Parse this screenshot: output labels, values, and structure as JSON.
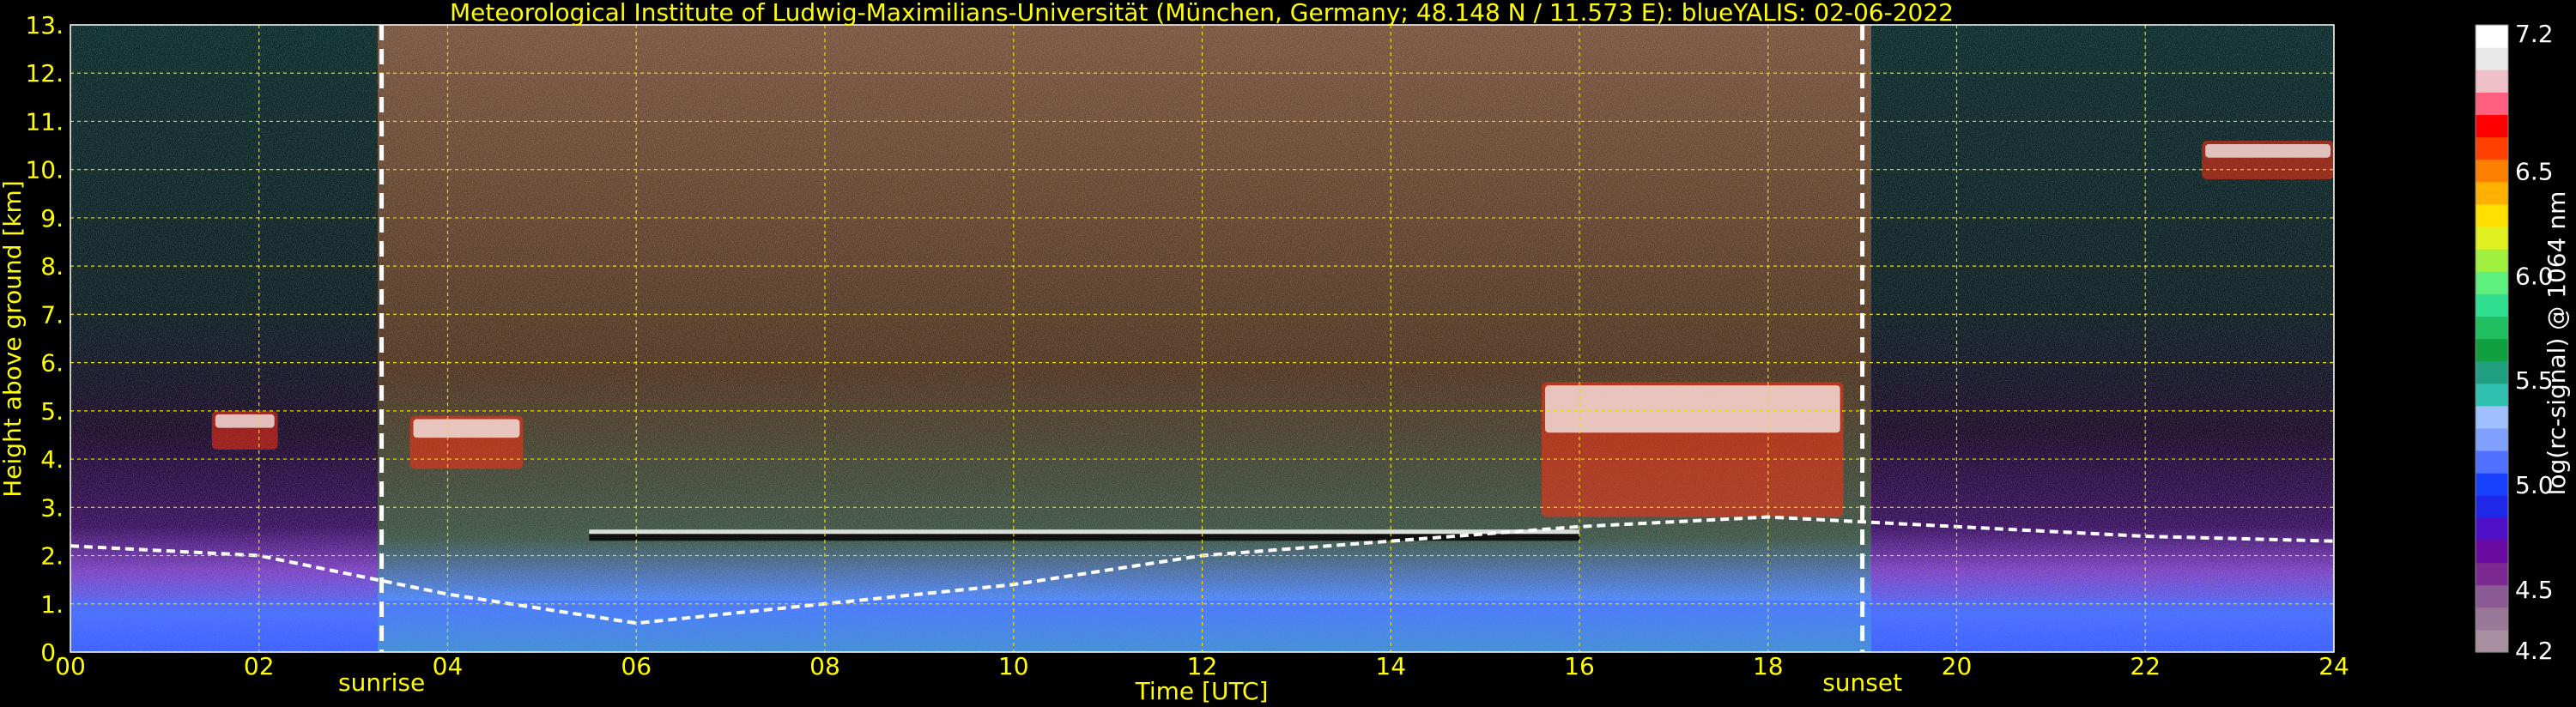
{
  "chart_data": {
    "type": "heatmap",
    "title": "Meteorological Institute of Ludwig-Maximilians-Universität (München, Germany; 48.148 N / 11.573 E):    blueYALIS: 02-06-2022",
    "xlabel": "Time [UTC]",
    "ylabel": "Height above ground [km]",
    "xlim": [
      0,
      24
    ],
    "ylim": [
      0,
      13
    ],
    "x_ticks": [
      "00",
      "02",
      "04",
      "06",
      "08",
      "10",
      "12",
      "14",
      "16",
      "18",
      "20",
      "22",
      "24"
    ],
    "y_ticks": [
      "0.",
      "1.",
      "2.",
      "3.",
      "4.",
      "5.",
      "6.",
      "7.",
      "8.",
      "9.",
      "10.",
      "11.",
      "12.",
      "13."
    ],
    "grid": true,
    "annotations": [
      {
        "label": "sunrise",
        "x": 3.3
      },
      {
        "label": "sunset",
        "x": 19.0
      }
    ],
    "colorbar": {
      "label": "log(rc-signal) @ 1064 nm",
      "range": [
        4.2,
        7.2
      ],
      "ticks": [
        "4.2",
        "4.5",
        "5.0",
        "5.5",
        "6.0",
        "6.5",
        "7.2"
      ],
      "tick_values": [
        4.2,
        4.5,
        5.0,
        5.5,
        6.0,
        6.5,
        7.2
      ],
      "colors": [
        "#a890a0",
        "#9a7898",
        "#8a5a94",
        "#7a2a90",
        "#6a0aa0",
        "#5010c8",
        "#2028e8",
        "#1840ff",
        "#5070ff",
        "#80a0ff",
        "#a0c0ff",
        "#30c0b0",
        "#20a080",
        "#10a040",
        "#20c060",
        "#30e090",
        "#60f080",
        "#a0f040",
        "#e0f020",
        "#ffe000",
        "#ffb000",
        "#ff8000",
        "#ff4000",
        "#ff0000",
        "#ff6080",
        "#f0c0c8",
        "#e8e8e8",
        "#ffffff"
      ]
    },
    "cloud_layers": [
      {
        "x_start": 1.5,
        "x_end": 2.2,
        "y_bottom": 4.2,
        "y_top": 5.0
      },
      {
        "x_start": 3.6,
        "x_end": 4.8,
        "y_bottom": 3.8,
        "y_top": 4.9
      },
      {
        "x_start": 15.6,
        "x_end": 18.8,
        "y_bottom": 2.8,
        "y_top": 5.6
      },
      {
        "x_start": 22.6,
        "x_end": 24.0,
        "y_bottom": 9.8,
        "y_top": 10.6
      },
      {
        "x_start": 5.5,
        "x_end": 16.0,
        "y_bottom": 1.9,
        "y_top": 2.9
      }
    ],
    "boundary_layer_top_km": [
      [
        0,
        2.2
      ],
      [
        2,
        2.0
      ],
      [
        4,
        1.2
      ],
      [
        6,
        0.6
      ],
      [
        8,
        1.0
      ],
      [
        10,
        1.4
      ],
      [
        12,
        2.0
      ],
      [
        14,
        2.3
      ],
      [
        16,
        2.6
      ],
      [
        18,
        2.8
      ],
      [
        20,
        2.6
      ],
      [
        22,
        2.4
      ],
      [
        24,
        2.3
      ]
    ]
  }
}
